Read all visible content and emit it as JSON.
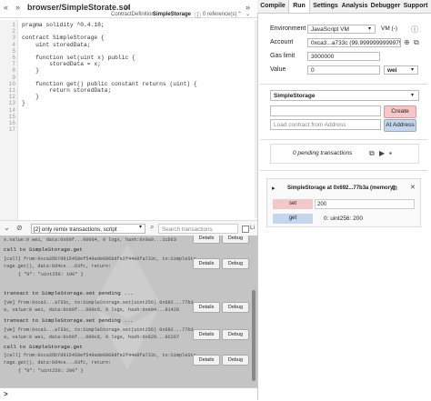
{
  "editor": {
    "file_tab": "browser/SimpleStorate.sol",
    "contract_definition_label": "ContractDefinition",
    "contract_definition_name": "SimpleStorage",
    "references": "0 reference(s)",
    "line_numbers": [
      "1",
      "2",
      "3",
      "4",
      "5",
      "6",
      "7",
      "8",
      "9",
      "10",
      "11",
      "12",
      "13",
      "14",
      "15",
      "16",
      "17"
    ],
    "code_lines": [
      "pragma solidity ^0.4.18;",
      "",
      "contract SimpleStorage {",
      "    uint storedData;",
      "",
      "    function set(uint x) public {",
      "        storedData = x;",
      "    }",
      "",
      "    function get() public constant returns (uint) {",
      "        return storedData;",
      "    }",
      "}",
      "",
      "",
      "",
      ""
    ]
  },
  "terminal": {
    "filter_select": "[2] only remix transactions, script",
    "search_placeholder": "Search transactions",
    "listen_label": "Li",
    "details_label": "Details",
    "debug_label": "Debug",
    "prompt": ">",
    "lines": {
      "log1": "s.value:0 wei, data:0x60f...00064, 0 logs, hash:0x0a0...1cb63",
      "call1": "call to SimpleStorage.get",
      "call1_a": "[call] from:0xca35b7d915458ef540ade6068dfe2f44e8fa733c, to:SimpleSto",
      "call1_b": "rage.get(), data:6d4ce...63fc, return:",
      "call1_ret": "{ \"0\": \"uint256: 100\" }",
      "pending1": "transact to SimpleStorage.set pending ...",
      "vm1_a": "[vm] from:0xca3...a733c, to:SimpleStorage.set(uint256) 0x692...77b3",
      "vm1_b": "a, value:0 wei, data:0x60f...000c8, 0 logs, hash:0xe94...81428",
      "pending2": "transact to SimpleStorage.set pending ...",
      "vm2_a": "[vm] from:0xca3...a733c, to:SimpleStorage.set(uint256) 0x692...77b3",
      "vm2_b": "a, value:0 wei, data:0x60f...000c8, 0 logs, hash:0x829...92207",
      "call2": "call to SimpleStorage.get",
      "call2_a": "[call] from:0xca35b7d915458ef540ade6068dfe2f44e8fa733c, to:SimpleSto",
      "call2_b": "rage.get(), data:6d4ce...63fc, return:",
      "call2_ret": "{ \"0\": \"uint256: 200\" }"
    }
  },
  "right_panel": {
    "tabs": [
      "Compile",
      "Run",
      "Settings",
      "Analysis",
      "Debugger",
      "Support"
    ],
    "active_tab": "Run",
    "environment_label": "Environment",
    "environment_value": "JavaScript VM",
    "vm_badge": "VM (-)",
    "account_label": "Account",
    "account_value": "0xca3...a733c (99.9999999999979621",
    "gas_limit_label": "Gas limit",
    "gas_limit_value": "3000000",
    "value_label": "Value",
    "value_value": "0",
    "value_unit": "wei",
    "contract_select": "SimpleStorage",
    "create_label": "Create",
    "load_placeholder": "Load contract from Address",
    "at_address_label": "At Address",
    "pending_text": "0 pending transactions",
    "instance_title": "SimpleStorage at 0x692...77b3a (memory)",
    "set_label": "set",
    "set_value": "200",
    "get_label": "get",
    "get_result": "0: uint256: 200"
  },
  "colors": {
    "create": "#f4c8c8",
    "at_address": "#c4d6ee",
    "set_button": "#f4c8c8",
    "get_button": "#c4d6ee"
  }
}
